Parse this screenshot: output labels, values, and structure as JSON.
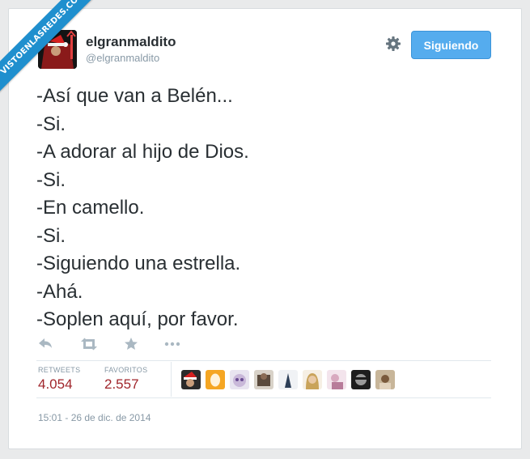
{
  "watermark": {
    "text": "VISTOENLASREDES.COM"
  },
  "tweet": {
    "display_name": "elgranmaldito",
    "handle": "@elgranmaldito",
    "follow_button_label": "Siguiendo",
    "lines": [
      "-Así que van a Belén...",
      "-Si.",
      "-A adorar al hijo de Dios.",
      "-Si.",
      "-En camello.",
      "-Si.",
      "-Siguiendo una estrella.",
      "-Ahá.",
      "-Soplen aquí, por favor."
    ],
    "actions": [
      "reply-icon",
      "retweet-icon",
      "favorite-icon",
      "more-icon"
    ],
    "stats": {
      "retweets_label": "RETWEETS",
      "retweets_value": "4.054",
      "favorites_label": "FAVORITOS",
      "favorites_value": "2.557"
    },
    "timestamp": "15:01 - 26 de dic. de 2014"
  },
  "colors": {
    "follow_button": "#55acee",
    "stat_value": "#a0252b",
    "ribbon": "#1f8fce",
    "text": "#292f33",
    "muted": "#8899a6"
  }
}
